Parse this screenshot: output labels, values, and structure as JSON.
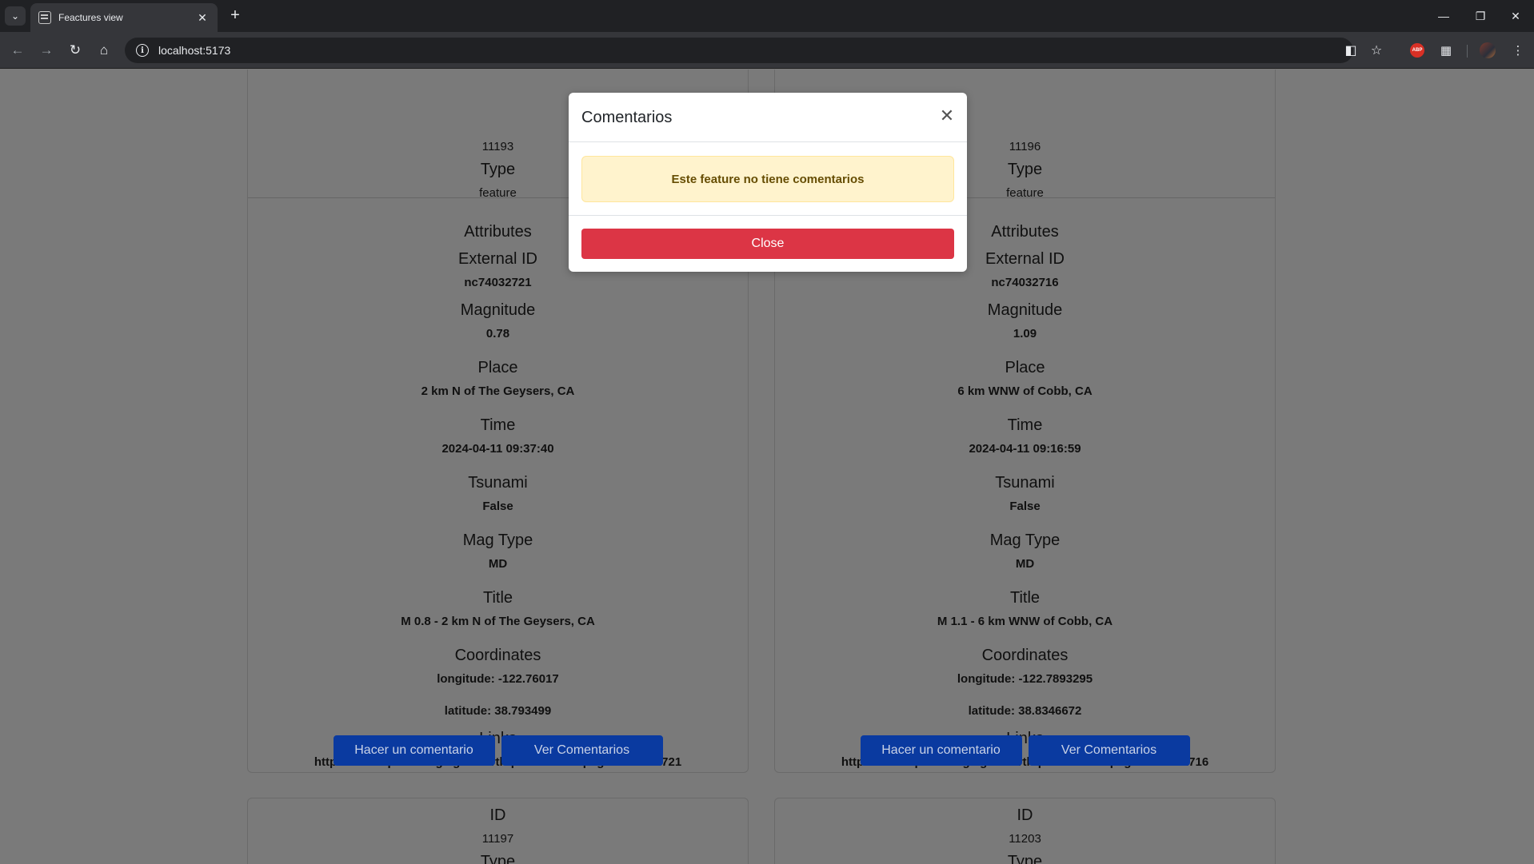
{
  "browser": {
    "tab_title": "Feactures view",
    "url": "localhost:5173",
    "abp_label": "ABP"
  },
  "cards_top": [
    {
      "id": "11193",
      "type_label": "Type",
      "type_value": "feature",
      "attributes_label": "Attributes",
      "external_id_label": "External ID",
      "external_id": "nc74032721",
      "magnitude_label": "Magnitude",
      "magnitude": "0.78",
      "place_label": "Place",
      "place": "2 km N of The Geysers, CA",
      "time_label": "Time",
      "time": "2024-04-11 09:37:40",
      "tsunami_label": "Tsunami",
      "tsunami": "False",
      "mag_type_label": "Mag Type",
      "mag_type": "MD",
      "title_label": "Title",
      "title": "M 0.8 - 2 km N of The Geysers, CA",
      "coordinates_label": "Coordinates",
      "longitude": "longitude: -122.76017",
      "latitude": "latitude: 38.793499",
      "links_label": "Links",
      "link": "https://earthquake.usgs.gov/earthquakes/eventpage/nc74032721",
      "comment_button": "Hacer un comentario",
      "view_comments_button": "Ver Comentarios"
    },
    {
      "id": "11196",
      "type_label": "Type",
      "type_value": "feature",
      "attributes_label": "Attributes",
      "external_id_label": "External ID",
      "external_id": "nc74032716",
      "magnitude_label": "Magnitude",
      "magnitude": "1.09",
      "place_label": "Place",
      "place": "6 km WNW of Cobb, CA",
      "time_label": "Time",
      "time": "2024-04-11 09:16:59",
      "tsunami_label": "Tsunami",
      "tsunami": "False",
      "mag_type_label": "Mag Type",
      "mag_type": "MD",
      "title_label": "Title",
      "title": "M 1.1 - 6 km WNW of Cobb, CA",
      "coordinates_label": "Coordinates",
      "longitude": "longitude: -122.7893295",
      "latitude": "latitude: 38.8346672",
      "links_label": "Links",
      "link": "https://earthquake.usgs.gov/earthquakes/eventpage/nc74032716",
      "comment_button": "Hacer un comentario",
      "view_comments_button": "Ver Comentarios"
    }
  ],
  "cards_bottom": [
    {
      "id_label": "ID",
      "id": "11197",
      "type_label": "Type"
    },
    {
      "id_label": "ID",
      "id": "11203",
      "type_label": "Type"
    }
  ],
  "modal": {
    "title": "Comentarios",
    "close_icon": "close-icon",
    "message": "Este feature no tiene comentarios",
    "close_button": "Close"
  },
  "colors": {
    "overlay_page": "#7a7a7a",
    "primary_button": "#0a3aa0",
    "danger_button": "#dc3545",
    "warning_bg": "#fff3cd"
  }
}
